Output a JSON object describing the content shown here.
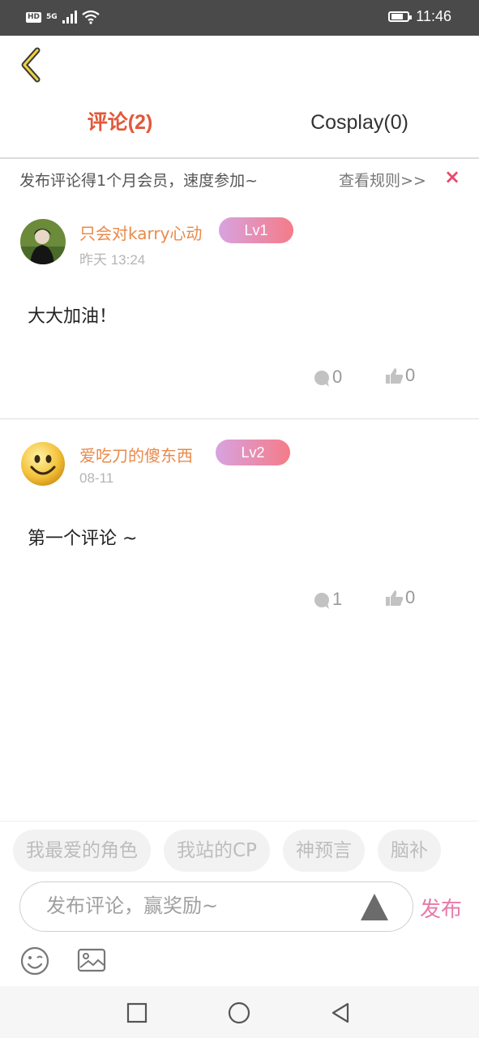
{
  "status_bar": {
    "hd": "HD",
    "network": "5G",
    "time": "11:46"
  },
  "tabs": [
    {
      "label": "评论(2)",
      "active": true
    },
    {
      "label": "Cosplay(0)",
      "active": false
    }
  ],
  "notice": {
    "text": "发布评论得1个月会员，速度参加~",
    "rules_link": "查看规则>>",
    "close": "×"
  },
  "comments": [
    {
      "username": "只会对karry心动",
      "level": "Lv1",
      "time": "昨天 13:24",
      "content": "大大加油！",
      "replies": "0",
      "likes": "0"
    },
    {
      "username": "爱吃刀的傻东西",
      "level": "Lv2",
      "time": "08-11",
      "content": "第一个评论 ~",
      "replies": "1",
      "likes": "0"
    }
  ],
  "topic_chips": [
    "我最爱的角色",
    "我站的CP",
    "神预言",
    "脑补"
  ],
  "comment_input": {
    "placeholder": "发布评论，赢奖励~",
    "publish_label": "发布"
  },
  "colors": {
    "active_tab": "#e2583a",
    "username": "#e98a4a",
    "publish": "#e879a8",
    "level_badge_start": "#d7a3e0",
    "level_badge_end": "#f57b88"
  }
}
